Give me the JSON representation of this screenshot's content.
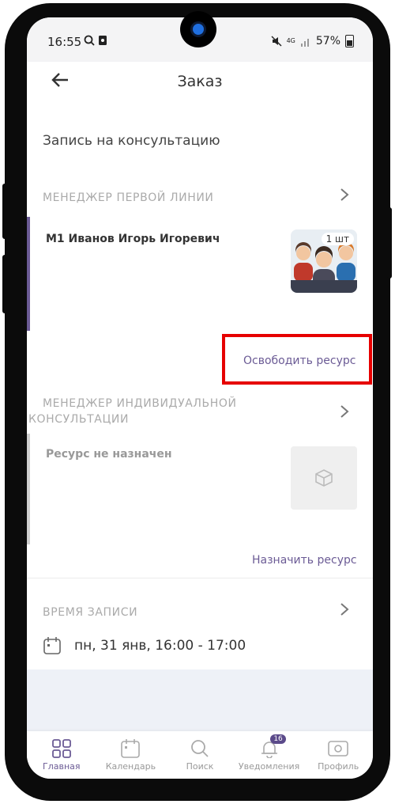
{
  "status_bar": {
    "time": "16:55",
    "battery": "57%",
    "network": "4G"
  },
  "header": {
    "title": "Заказ",
    "back_icon": "arrow-left-icon"
  },
  "page": {
    "section_title": "Запись на консультацию"
  },
  "first_line": {
    "label": "МЕНЕДЖЕР ПЕРВОЙ ЛИНИИ",
    "resource_name": "М1 Иванов Игорь Игоревич",
    "quantity": "1 шт",
    "action": "Освободить ресурс"
  },
  "individual": {
    "label_line1": "МЕНЕДЖЕР ИНДИВИДУАЛЬНОЙ",
    "label_line2": "КОНСУЛЬТАЦИИ",
    "resource_name": "Ресурс не назначен",
    "action": "Назначить ресурс"
  },
  "time_section": {
    "label": "ВРЕМЯ ЗАПИСИ",
    "value": "пн, 31 янв, 16:00 - 17:00"
  },
  "tabs": [
    {
      "label": "Главная",
      "icon": "grid-icon"
    },
    {
      "label": "Календарь",
      "icon": "calendar-icon"
    },
    {
      "label": "Поиск",
      "icon": "search-icon"
    },
    {
      "label": "Уведомления",
      "icon": "bell-icon",
      "badge": "16"
    },
    {
      "label": "Профиль",
      "icon": "profile-icon"
    }
  ],
  "colors": {
    "accent": "#6b5b95",
    "highlight": "#e60000"
  }
}
